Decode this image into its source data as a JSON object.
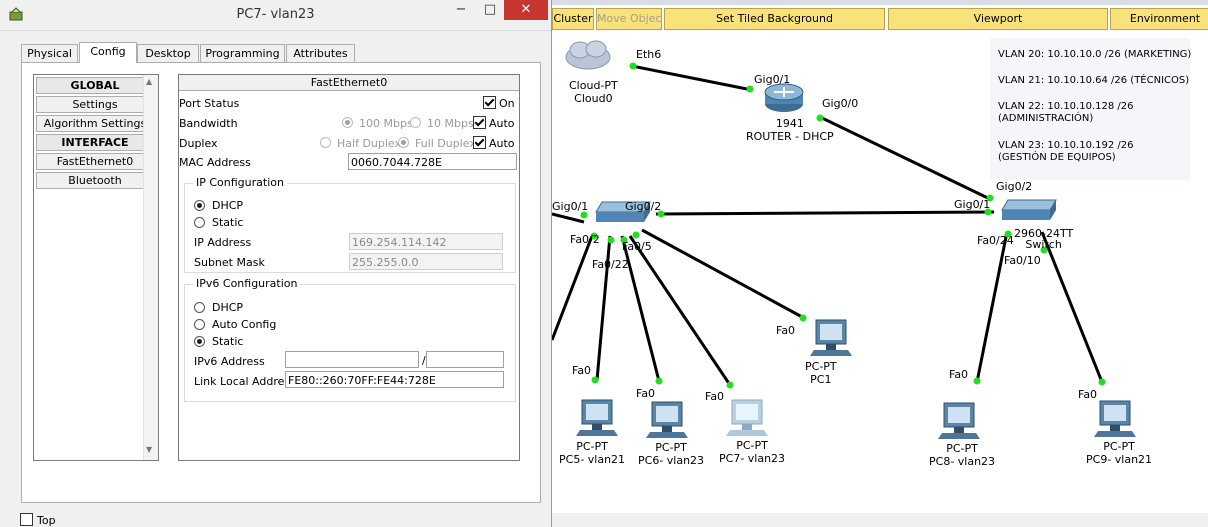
{
  "window": {
    "title": "PC7- vlan23",
    "minimize": "−",
    "maximize": "□",
    "close": "✕"
  },
  "tabs": [
    "Physical",
    "Config",
    "Desktop",
    "Programming",
    "Attributes"
  ],
  "active_tab": "Config",
  "nav": {
    "global_header": "GLOBAL",
    "settings": "Settings",
    "algorithm_settings": "Algorithm Settings",
    "interface_header": "INTERFACE",
    "fastethernet": "FastEthernet0",
    "bluetooth": "Bluetooth"
  },
  "config": {
    "panel_title": "FastEthernet0",
    "port_status_label": "Port Status",
    "port_status_on": "On",
    "bandwidth_label": "Bandwidth",
    "bw_100": "100 Mbps",
    "bw_10": "10 Mbps",
    "bw_auto": "Auto",
    "duplex_label": "Duplex",
    "half_duplex": "Half Duplex",
    "full_duplex": "Full Duplex",
    "duplex_auto": "Auto",
    "mac_label": "MAC Address",
    "mac_value": "0060.7044.728E",
    "ipcfg": {
      "title": "IP Configuration",
      "dhcp": "DHCP",
      "static": "Static",
      "ip_label": "IP Address",
      "ip_value": "169.254.114.142",
      "mask_label": "Subnet Mask",
      "mask_value": "255.255.0.0"
    },
    "ipv6": {
      "title": "IPv6 Configuration",
      "dhcp": "DHCP",
      "auto": "Auto Config",
      "static": "Static",
      "addr_label": "IPv6 Address",
      "addr_value": "",
      "prefix_sep": "/",
      "prefix_value": "",
      "link_local_label": "Link Local Address:",
      "link_local_value": "FE80::260:70FF:FE44:728E"
    }
  },
  "bottom": {
    "top_label": "Top"
  },
  "workspace": {
    "toolbar": {
      "cluster": "Cluster",
      "move_object": "Move Object",
      "set_tiled_bg": "Set Tiled Background",
      "viewport": "Viewport",
      "environment": "Environment"
    },
    "nodes": {
      "cloud": [
        "Cloud-PT",
        "Cloud0"
      ],
      "router": [
        "1941",
        "ROUTER - DHCP"
      ],
      "switch_right": "2960-24TT",
      "switch_right_sub": "Switch",
      "pc1": [
        "PC-PT",
        "PC1"
      ],
      "pc5": [
        "PC-PT",
        "PC5- vlan21"
      ],
      "pc6": [
        "PC-PT",
        "PC6- vlan23"
      ],
      "pc7": [
        "PC-PT",
        "PC7- vlan23"
      ],
      "pc8": [
        "PC-PT",
        "PC8- vlan23"
      ],
      "pc9": [
        "PC-PT",
        "PC9- vlan21"
      ]
    },
    "ports": {
      "eth6": "Eth6",
      "r_gig01": "Gig0/1",
      "r_gig00": "Gig0/0",
      "sr_gig02": "Gig0/2",
      "sr_gig01": "Gig0/1",
      "sr_fa024": "Fa0/24",
      "sr_fa010": "Fa0/10",
      "sl_gig01": "Gig0/1",
      "sl_gig02": "Gig0/2",
      "sl_fa02": "Fa0/2",
      "sl_fa05": "Fa0/5",
      "sl_fa022": "Fa0/22",
      "pc1_fa0": "Fa0",
      "pc5_fa0": "Fa0",
      "pc6_fa0": "Fa0",
      "pc7_fa0": "Fa0",
      "pc8_fa0": "Fa0",
      "pc9_fa0": "Fa0"
    },
    "vlan_notes": [
      "VLAN 20: 10.10.10.0 /26 (MARKETING)",
      "VLAN 21: 10.10.10.64 /26 (TÉCNICOS)",
      "VLAN 22: 10.10.10.128 /26",
      "(ADMINISTRACIÓN)",
      "VLAN 23: 10.10.10.192 /26",
      "(GESTIÓN DE EQUIPOS)"
    ]
  },
  "colors": {
    "close_button": "#c7372f",
    "toolbar_yellow": "#f9e27a",
    "link_light": "#22dd22"
  }
}
